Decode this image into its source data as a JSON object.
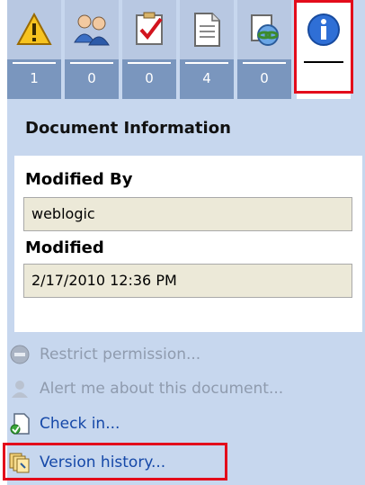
{
  "tabs": [
    {
      "id": "warnings",
      "icon": "warning-icon",
      "count": "1"
    },
    {
      "id": "people",
      "icon": "users-icon",
      "count": "0"
    },
    {
      "id": "tasks",
      "icon": "task-checklist-icon",
      "count": "0"
    },
    {
      "id": "documents",
      "icon": "document-icon",
      "count": "4"
    },
    {
      "id": "links",
      "icon": "link-icon",
      "count": "0"
    },
    {
      "id": "info",
      "icon": "info-icon",
      "count": ""
    }
  ],
  "document_info": {
    "title": "Document Information",
    "modified_by_label": "Modified By",
    "modified_by_value": "weblogic",
    "modified_label": "Modified",
    "modified_value": "2/17/2010 12:36 PM"
  },
  "actions": {
    "restrict": "Restrict permission...",
    "alert": "Alert me about this document...",
    "checkin": "Check in...",
    "version_history": "Version history..."
  },
  "colors": {
    "highlight": "#e30c1b",
    "panel": "#c7d7ee",
    "link": "#1548a8",
    "disabled": "#8f9bae"
  }
}
